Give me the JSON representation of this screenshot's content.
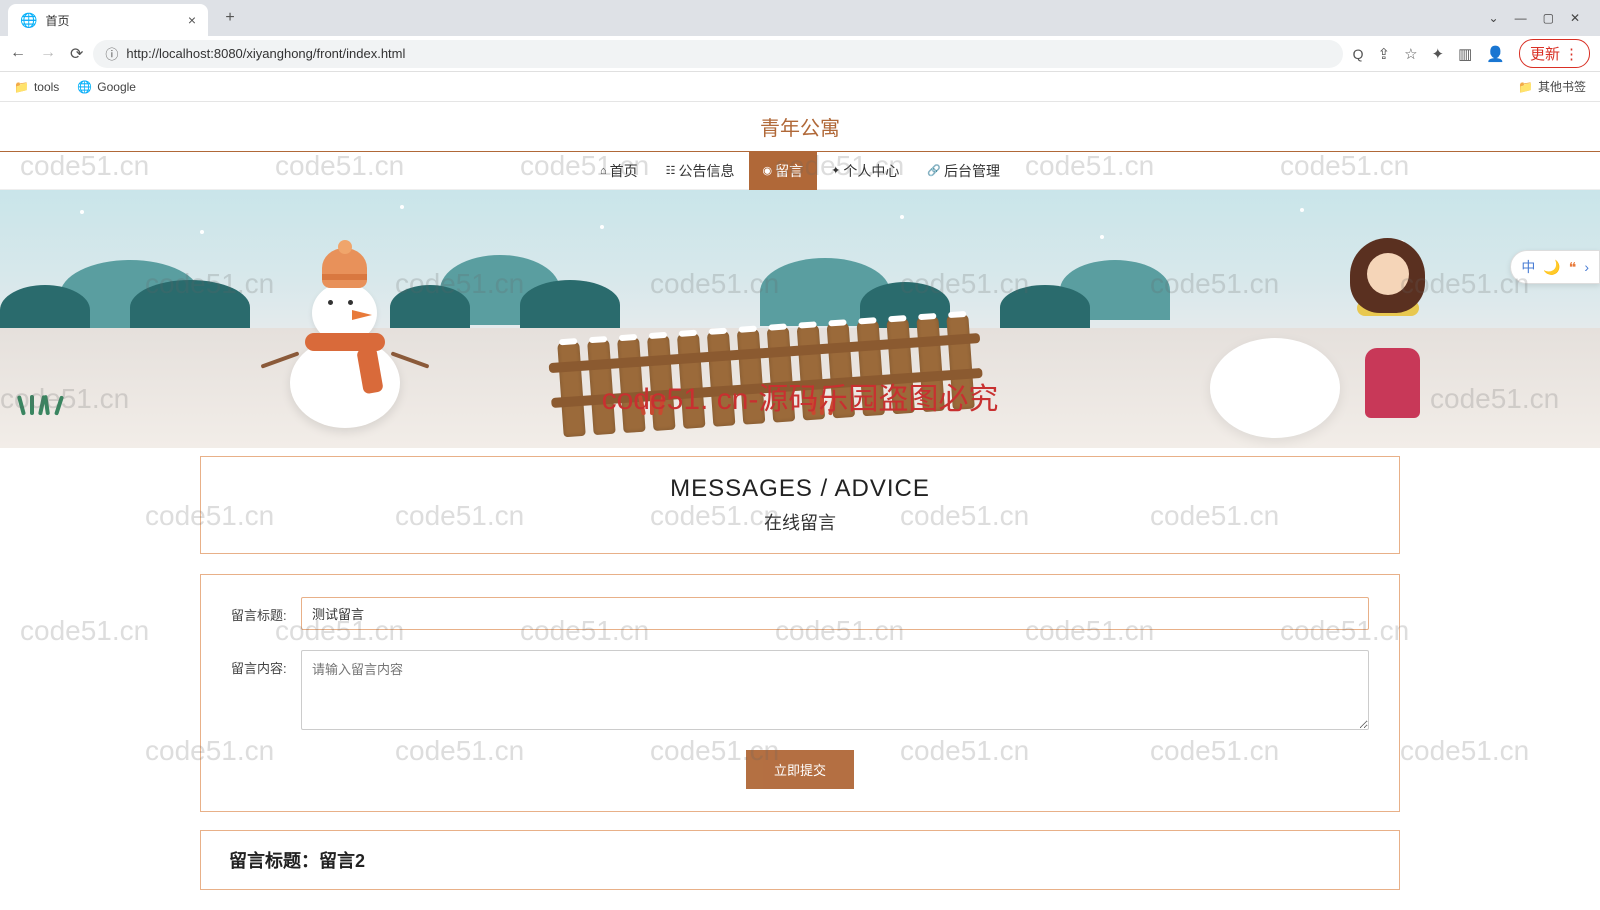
{
  "browser": {
    "tab_title": "首页",
    "url": "http://localhost:8080/xiyanghong/front/index.html",
    "update_label": "更新",
    "bookmarks": {
      "tools": "tools",
      "google": "Google",
      "other": "其他书签"
    }
  },
  "site": {
    "title": "青年公寓"
  },
  "nav": {
    "home": "首页",
    "announce": "公告信息",
    "message": "留言",
    "profile": "个人中心",
    "admin": "后台管理"
  },
  "hero": {
    "watermark_center": "code51. cn-源码乐园盗图必究",
    "watermark_repeat": "code51.cn",
    "side_tool_lang": "中"
  },
  "section": {
    "title_en": "MESSAGES / ADVICE",
    "title_cn": "在线留言"
  },
  "form": {
    "title_label": "留言标题:",
    "title_value": "测试留言",
    "content_label": "留言内容:",
    "content_placeholder": "请输入留言内容",
    "submit_label": "立即提交"
  },
  "list": {
    "item1_title": "留言标题：留言2"
  }
}
